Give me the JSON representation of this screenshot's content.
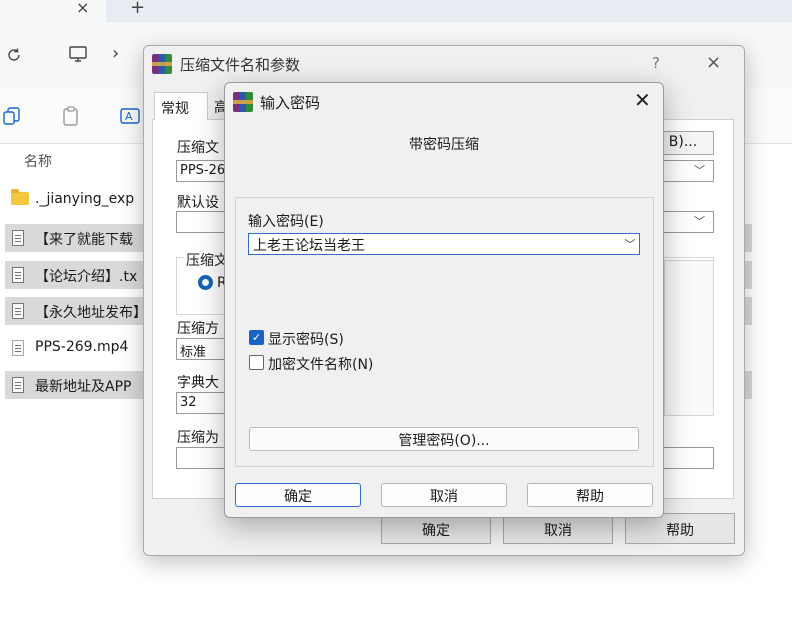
{
  "explorer": {
    "tab_close_glyph": "×",
    "tab_new_glyph": "+",
    "column_name": "名称",
    "chevron": "›",
    "files": [
      {
        "name": "._jianying_exp",
        "type": "folder"
      },
      {
        "name": "【来了就能下载",
        "type": "file"
      },
      {
        "name": "【论坛介绍】.tx",
        "type": "file"
      },
      {
        "name": "【永久地址发布】",
        "type": "file"
      },
      {
        "name": "PPS-269.mp4",
        "type": "file"
      },
      {
        "name": "最新地址及APP",
        "type": "file"
      }
    ]
  },
  "main_dialog": {
    "title": "压缩文件名和参数",
    "help_glyph": "?",
    "close_glyph": "×",
    "tabs": [
      "常规",
      "高"
    ],
    "archive_name_label": "压缩文",
    "archive_name_value": "PPS-26",
    "browse_label": "B)...",
    "default_profile_label": "默认设",
    "format_label": "压缩文",
    "format_option": "R",
    "method_label": "压缩方",
    "method_value": "标准",
    "dict_label": "字典大",
    "dict_value": "32",
    "split_label": "压缩为",
    "ok": "确定",
    "cancel": "取消",
    "help": "帮助"
  },
  "password_dialog": {
    "title": "输入密码",
    "close_glyph": "✕",
    "heading": "带密码压缩",
    "password_label": "输入密码(E)",
    "password_value": "上老王论坛当老王",
    "show_password_label": "显示密码(S)",
    "show_password_checked": true,
    "encrypt_names_label": "加密文件名称(N)",
    "encrypt_names_checked": false,
    "manage_button": "管理密码(O)...",
    "ok": "确定",
    "cancel": "取消",
    "help": "帮助"
  },
  "colors": {
    "accent": "#1664c6",
    "focus_border": "#2f6bd1"
  }
}
